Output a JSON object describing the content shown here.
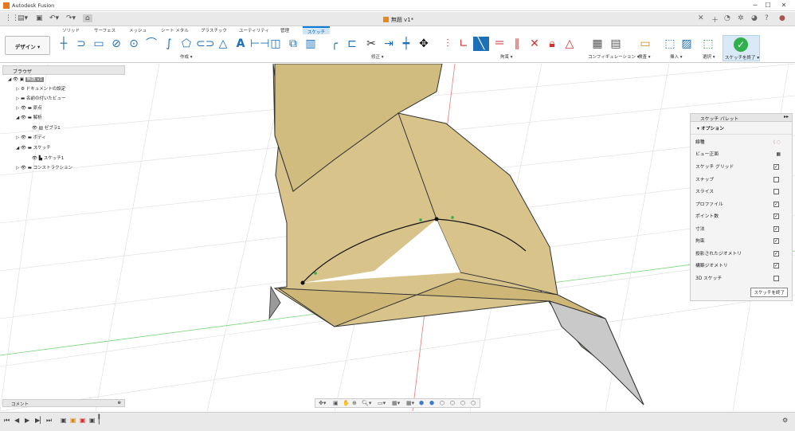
{
  "app": {
    "title": "Autodesk Fusion",
    "doc_title": "無題 v1*"
  },
  "tabs": [
    {
      "label": "ソリッド"
    },
    {
      "label": "サーフェス"
    },
    {
      "label": "メッシュ"
    },
    {
      "label": "シート メタル"
    },
    {
      "label": "プラスチック"
    },
    {
      "label": "ユーティリティ"
    },
    {
      "label": "管理"
    },
    {
      "label": "スケッチ"
    }
  ],
  "ribbon": {
    "design": "デザイン ▾",
    "groups": {
      "create": "作成 ▾",
      "modify": "修正 ▾",
      "constraints": "拘束 ▾",
      "configure": "コンフィギュレーション ▾",
      "inspect": "検査 ▾",
      "insert": "挿入 ▾",
      "select": "選択 ▾"
    },
    "finish": "スケッチを終了 ▾"
  },
  "browser": {
    "title": "ブラウザ",
    "items": [
      {
        "label": "無題 v1"
      },
      {
        "label": "ドキュメントの設定"
      },
      {
        "label": "名前の付いたビュー"
      },
      {
        "label": "原点"
      },
      {
        "label": "解析"
      },
      {
        "label": "ゼブラ1"
      },
      {
        "label": "ボディ"
      },
      {
        "label": "スケッチ"
      },
      {
        "label": "スケッチ1"
      },
      {
        "label": "コンストラクション"
      }
    ]
  },
  "palette": {
    "title": "スケッチ パレット",
    "section": "オプション",
    "rows": [
      {
        "label": "線種"
      },
      {
        "label": "ビュー正面"
      },
      {
        "label": "スケッチ グリッド",
        "checked": "✓"
      },
      {
        "label": "スナップ",
        "checked": ""
      },
      {
        "label": "スライス",
        "checked": ""
      },
      {
        "label": "プロファイル",
        "checked": "✓"
      },
      {
        "label": "ポイント数",
        "checked": "✓"
      },
      {
        "label": "寸法",
        "checked": "✓"
      },
      {
        "label": "拘束",
        "checked": "✓"
      },
      {
        "label": "投影されたジオメトリ",
        "checked": "✓"
      },
      {
        "label": "構築ジオメトリ",
        "checked": "✓"
      },
      {
        "label": "3D スケッチ",
        "checked": ""
      }
    ],
    "finish": "スケッチを終了"
  },
  "comments": "コメント",
  "colors": {
    "surface": "#d8c38a",
    "surface_dark": "#b9a468",
    "accent": "#0b7dd6",
    "finish": "#2fb04a"
  }
}
